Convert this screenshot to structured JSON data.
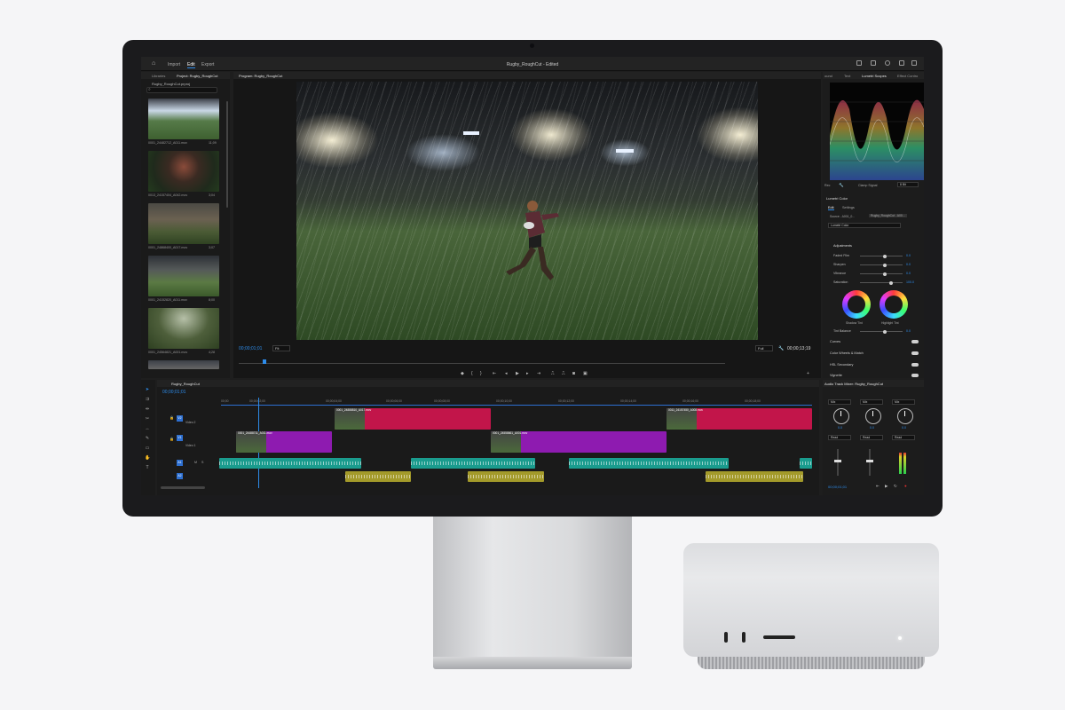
{
  "window": {
    "nav_tabs": [
      "Import",
      "Edit",
      "Export"
    ],
    "active_tab": "Edit",
    "doc_title": "Rugby_RoughCut - Edited"
  },
  "project_panel": {
    "tabs": [
      "Libraries",
      "Project: Rugby_RoughCut"
    ],
    "file_name": "Rugby_RoughCut.prproj",
    "clips": [
      {
        "name": "0001_24482712_A011.mov",
        "duration": "11;09"
      },
      {
        "name": "0013_24157404_A042.mov",
        "duration": "3;04"
      },
      {
        "name": "0001_24868400_A017.mov",
        "duration": "3;07"
      },
      {
        "name": "0001_24152820_A011.mov",
        "duration": "8;00"
      },
      {
        "name": "0001_24564821_A001.mov",
        "duration": "4;28"
      }
    ]
  },
  "program_monitor": {
    "tab": "Program: Rugby_RoughCut",
    "timecode_left": "00;00;01;01",
    "timecode_right": "00;00;13;19",
    "fit_label": "Fit",
    "quality_label": "Full"
  },
  "scopes": {
    "tabs": [
      "ound",
      "Text",
      "Lumetri Scopes",
      "Effect Contro"
    ],
    "clamp_label": "Clamp Signal",
    "bit_depth": "8 Bit",
    "bottom_left": "Rec"
  },
  "lumetri": {
    "title": "Lumetri Color",
    "tabs": [
      "Edit",
      "Settings"
    ],
    "source_label": "Source - A001_0...",
    "sequence_label": "Rugby_RoughCut - A00...",
    "effect_select": "Lumetri Color",
    "adjustments_label": "Adjustments",
    "sliders": [
      {
        "label": "Faded Film",
        "value": "0.0",
        "pos": 0.55
      },
      {
        "label": "Sharpen",
        "value": "0.0",
        "pos": 0.55
      },
      {
        "label": "Vibrance",
        "value": "0.0",
        "pos": 0.55
      },
      {
        "label": "Saturation",
        "value": "100.0",
        "pos": 0.7
      }
    ],
    "wheel_labels": [
      "Shadow Tint",
      "Highlight Tint"
    ],
    "tint_label": "Tint Balance",
    "tint_value": "0.0",
    "sections": [
      "Curves",
      "Color Wheels & Match",
      "HSL Secondary",
      "Vignette"
    ]
  },
  "timeline": {
    "tab": "Rugby_RoughCut",
    "timecode": "00;00;01;01",
    "ruler": [
      "00;00",
      "00;00;02;00",
      "00;00;04;00",
      "00;00;06;00",
      "00;00;08;00",
      "00;00;10;00",
      "00;00;12;00",
      "00;00;14;00",
      "00;00;16;00",
      "00;00;18;00"
    ],
    "tracks": [
      {
        "tag": "V2",
        "name": "Video 2"
      },
      {
        "tag": "V1",
        "name": "Video 1"
      },
      {
        "tag": "A1",
        "name": ""
      },
      {
        "tag": "A2",
        "name": ""
      }
    ],
    "clips_v2": [
      {
        "name": "0001_24888810_A017.mov"
      },
      {
        "name": "0011_24157450_A008.mov"
      }
    ],
    "clips_v1": [
      {
        "name": "0001_24488711_A011.mov"
      },
      {
        "name": "0001_24558661_A001.mov"
      }
    ]
  },
  "mixer": {
    "title": "Audio Track Mixer: Rugby_RoughCut",
    "channels": [
      {
        "mode": "Mix",
        "pan": "0.0",
        "read": "Read"
      },
      {
        "mode": "Mix",
        "pan": "0.0",
        "read": "Read"
      },
      {
        "mode": "Mix",
        "pan": "0.0",
        "read": "Read"
      }
    ],
    "timecode": "00;00;01;01"
  },
  "colors": {
    "accent": "#2d8ceb",
    "v2_clip": "#c2154a",
    "v1_clip": "#8e1bb0",
    "a1_clip": "#1a9c8e",
    "a2_clip": "#a39a2a"
  },
  "icons": [
    "home-icon",
    "search-icon",
    "wrench-icon",
    "play-icon",
    "step-back-icon",
    "step-forward-icon",
    "camera-icon",
    "add-icon",
    "selection-tool-icon",
    "razor-tool-icon",
    "pen-tool-icon",
    "hand-tool-icon",
    "type-tool-icon",
    "lock-icon",
    "eye-icon",
    "mute-icon",
    "solo-icon"
  ]
}
